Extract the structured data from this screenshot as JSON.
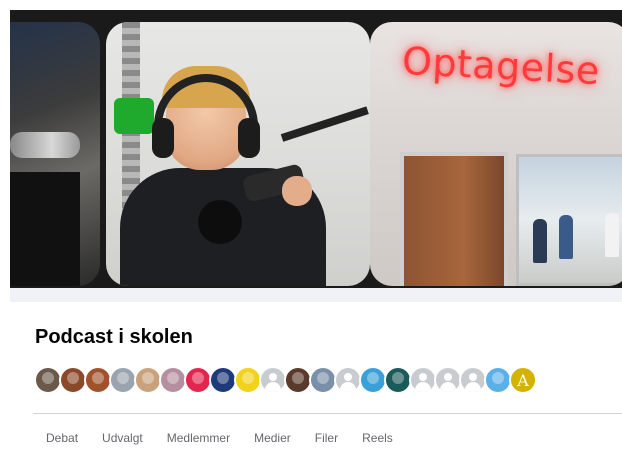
{
  "cover": {
    "sign_text": "Optagelse"
  },
  "group": {
    "title": "Podcast i skolen"
  },
  "members": {
    "avatars": [
      {
        "icon": "member-photo-icon",
        "color": "#6b5a4a"
      },
      {
        "icon": "member-photo-icon",
        "color": "#8a4a2a"
      },
      {
        "icon": "member-photo-icon",
        "color": "#a0522d"
      },
      {
        "icon": "member-photo-icon",
        "color": "#9aa4ae"
      },
      {
        "icon": "member-photo-icon",
        "color": "#c9a27c"
      },
      {
        "icon": "member-photo-icon",
        "color": "#b58fa0"
      },
      {
        "icon": "member-logo-icon",
        "color": "#e2264d"
      },
      {
        "icon": "member-logo-icon",
        "color": "#1f3a7a"
      },
      {
        "icon": "member-logo-icon",
        "color": "#f2d21b"
      },
      {
        "icon": "default-avatar-icon",
        "color": "#c8cbd0"
      },
      {
        "icon": "member-photo-icon",
        "color": "#5a3a2a"
      },
      {
        "icon": "member-photo-icon",
        "color": "#7a8fa8"
      },
      {
        "icon": "default-avatar-icon",
        "color": "#c8cbd0"
      },
      {
        "icon": "member-logo-icon",
        "color": "#3aa0d8"
      },
      {
        "icon": "member-logo-icon",
        "color": "#1a5a5a"
      },
      {
        "icon": "default-avatar-icon",
        "color": "#c8cbd0"
      },
      {
        "icon": "default-avatar-icon",
        "color": "#c8cbd0"
      },
      {
        "icon": "default-avatar-icon",
        "color": "#c8cbd0"
      },
      {
        "icon": "member-logo-icon",
        "color": "#5bb0e8"
      },
      {
        "icon": "letter-avatar-icon",
        "color": "#d4b200",
        "letter": "A"
      }
    ]
  },
  "tabs": [
    {
      "label": "Debat"
    },
    {
      "label": "Udvalgt"
    },
    {
      "label": "Medlemmer"
    },
    {
      "label": "Medier"
    },
    {
      "label": "Filer"
    },
    {
      "label": "Reels"
    }
  ]
}
